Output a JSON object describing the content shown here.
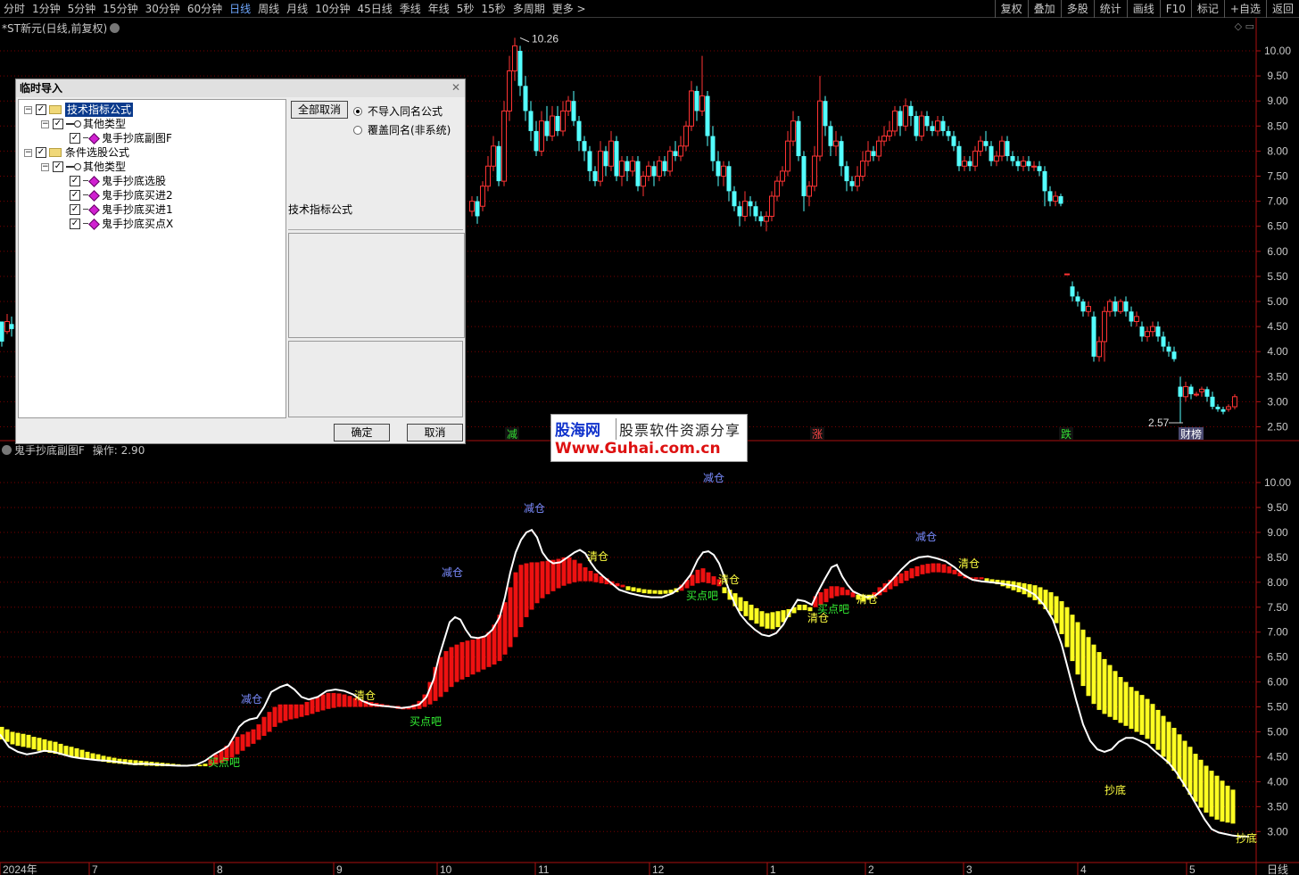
{
  "toolbar": {
    "period_tabs": [
      "分时",
      "1分钟",
      "5分钟",
      "15分钟",
      "30分钟",
      "60分钟",
      "日线",
      "周线",
      "月线",
      "10分钟",
      "45日线",
      "季线",
      "年线",
      "5秒",
      "15秒",
      "多周期",
      "更多 >"
    ],
    "active_period": "日线",
    "right_tools": [
      "复权",
      "叠加",
      "多股",
      "统计",
      "画线",
      "F10",
      "标记",
      "+自选",
      "返回"
    ]
  },
  "main_pane": {
    "title": "*ST新元(日线,前复权)",
    "high_label": "10.26",
    "low_label": "2.57",
    "price_ticks": [
      "10.00",
      "9.50",
      "9.00",
      "8.50",
      "8.00",
      "7.50",
      "7.00",
      "6.50",
      "6.00",
      "5.50",
      "5.00",
      "4.50",
      "4.00",
      "3.50",
      "3.00",
      "2.50"
    ],
    "markers": [
      {
        "text": "减",
        "color": "#33dd33"
      },
      {
        "text": "涨",
        "color": "#ff4444"
      },
      {
        "text": "跌",
        "color": "#33dd33"
      },
      {
        "text": "财榜",
        "color": "#ffffff"
      }
    ]
  },
  "sub_pane": {
    "title": "鬼手抄底副图F",
    "op_label": "操作:",
    "op_value": "2.90",
    "price_ticks": [
      "10.00",
      "9.50",
      "9.00",
      "8.50",
      "8.00",
      "7.50",
      "7.00",
      "6.50",
      "6.00",
      "5.50",
      "5.00",
      "4.50",
      "4.00",
      "3.50",
      "3.00"
    ],
    "signals": [
      {
        "text": "减仓",
        "color": "#7b8cff"
      },
      {
        "text": "减仓",
        "color": "#7b8cff"
      },
      {
        "text": "减仓",
        "color": "#7b8cff"
      },
      {
        "text": "减仓",
        "color": "#7b8cff"
      },
      {
        "text": "减仓",
        "color": "#7b8cff"
      },
      {
        "text": "清仓",
        "color": "#ffff40"
      },
      {
        "text": "清仓",
        "color": "#ffff40"
      },
      {
        "text": "清仓",
        "color": "#ffff40"
      },
      {
        "text": "清仓",
        "color": "#ffff40"
      },
      {
        "text": "清仓",
        "color": "#ffff40"
      },
      {
        "text": "清仓",
        "color": "#ffff40"
      },
      {
        "text": "买点吧",
        "color": "#33ee33"
      },
      {
        "text": "买点吧",
        "color": "#33ee33"
      },
      {
        "text": "买点吧",
        "color": "#33ee33"
      },
      {
        "text": "买点吧",
        "color": "#33ee33"
      },
      {
        "text": "抄底",
        "color": "#ffff40"
      },
      {
        "text": "抄底",
        "color": "#ffff40"
      }
    ]
  },
  "time_axis": {
    "labels": [
      "2024年",
      "7",
      "8",
      "9",
      "10",
      "11",
      "12",
      "1",
      "2",
      "3",
      "4",
      "5"
    ],
    "period_label": "日线"
  },
  "watermark": {
    "brand": "股海网",
    "tagline": "股票软件资源分享",
    "url": "Www.Guhai.com.cn"
  },
  "dialog": {
    "title": "临时导入",
    "tree": [
      {
        "label": "技术指标公式",
        "level": 0,
        "kind": "folder",
        "checked": true,
        "selected": true
      },
      {
        "label": "其他类型",
        "level": 1,
        "kind": "key",
        "checked": true
      },
      {
        "label": "鬼手抄底副图F",
        "level": 2,
        "kind": "formula",
        "checked": true
      },
      {
        "label": "条件选股公式",
        "level": 0,
        "kind": "folder",
        "checked": true
      },
      {
        "label": "其他类型",
        "level": 1,
        "kind": "key",
        "checked": true
      },
      {
        "label": "鬼手抄底选股",
        "level": 2,
        "kind": "formula",
        "checked": true
      },
      {
        "label": "鬼手抄底买进2",
        "level": 2,
        "kind": "formula",
        "checked": true
      },
      {
        "label": "鬼手抄底买进1",
        "level": 2,
        "kind": "formula",
        "checked": true
      },
      {
        "label": "鬼手抄底买点X",
        "level": 2,
        "kind": "formula",
        "checked": true
      }
    ],
    "cancel_all_label": "全部取消",
    "radio_options": [
      {
        "label": "不导入同名公式",
        "selected": true
      },
      {
        "label": "覆盖同名(非系统)",
        "selected": false
      }
    ],
    "type_label": "技术指标公式",
    "ok_label": "确定",
    "cancel_label": "取消"
  },
  "colors": {
    "up_candle": "#ff3333",
    "down_candle": "#54ffff",
    "red_bar": "#ee1111",
    "yellow_bar": "#ffff22",
    "white_line": "#ffffff",
    "grid": "#7a0000",
    "axis_text": "#c8c8c8"
  }
}
